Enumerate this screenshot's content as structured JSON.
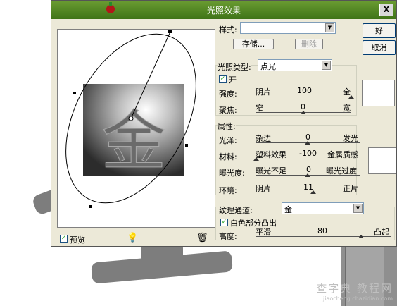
{
  "dialog": {
    "title": "光照效果",
    "close": "X",
    "buttons": {
      "ok": "好",
      "cancel": "取消"
    },
    "style": {
      "label": "样式:",
      "value": "",
      "save": "存储...",
      "delete": "删除"
    },
    "light_type": {
      "label": "光照类型:",
      "value": "点光",
      "on_label": "开",
      "on_checked": true
    },
    "intensity": {
      "label": "强度:",
      "left": "阴片",
      "value": "100",
      "right": "全"
    },
    "focus": {
      "label": "聚焦:",
      "left": "窄",
      "value": "0",
      "right": "宽"
    },
    "properties": {
      "header": "属性:",
      "gloss": {
        "label": "光泽:",
        "left": "杂边",
        "value": "0",
        "right": "发光"
      },
      "material": {
        "label": "材料:",
        "left": "塑料效果",
        "value": "-100",
        "right": "金属质感"
      },
      "exposure": {
        "label": "曝光度:",
        "left": "曝光不足",
        "value": "0",
        "right": "曝光过度"
      },
      "ambience": {
        "label": "环境:",
        "left": "阴片",
        "value": "11",
        "right": "正片"
      }
    },
    "texture": {
      "label": "纹理通道:",
      "value": "金",
      "white_high_label": "白色部分凸出",
      "white_high_checked": true,
      "height": {
        "label": "高度:",
        "left": "平滑",
        "value": "80",
        "right": "凸起"
      }
    },
    "preview": {
      "label": "预览",
      "checked": true,
      "glyph": "金"
    }
  },
  "watermark": {
    "main": "查字典 教程网",
    "sub": "jiaocheng.chazidian.com"
  },
  "colors": {
    "titlebar": "#4f8a22",
    "dialog_bg": "#ece9d8",
    "check": "#21a121"
  }
}
